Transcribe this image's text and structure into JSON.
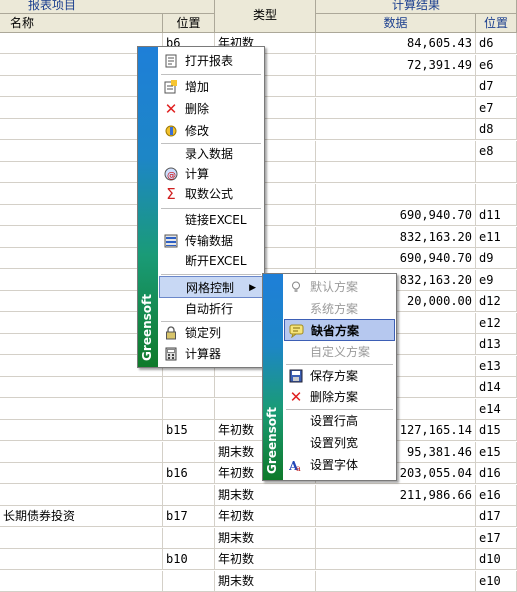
{
  "header": {
    "group_report_item": "报表项目",
    "col_name": "名称",
    "col_position": "位置",
    "col_type": "类型",
    "group_calc_result": "计算结果",
    "col_data": "数据",
    "col_position2": "位置"
  },
  "rows": [
    {
      "name": "",
      "pos": "b6",
      "type": "年初数",
      "data": "84,605.43",
      "pos2": "d6"
    },
    {
      "name": "",
      "pos": "",
      "type": "",
      "data": "72,391.49",
      "pos2": "e6"
    },
    {
      "name": "",
      "pos": "",
      "type": "",
      "data": "",
      "pos2": "d7"
    },
    {
      "name": "",
      "pos": "",
      "type": "",
      "data": "",
      "pos2": "e7"
    },
    {
      "name": "",
      "pos": "",
      "type": "",
      "data": "",
      "pos2": "d8"
    },
    {
      "name": "",
      "pos": "",
      "type": "",
      "data": "",
      "pos2": "e8"
    },
    {
      "name": "",
      "pos": "",
      "type": "",
      "data": "",
      "pos2": ""
    },
    {
      "name": "",
      "pos": "",
      "type": "",
      "data": "",
      "pos2": ""
    },
    {
      "name": "",
      "pos": "",
      "type": "",
      "data": "690,940.70",
      "pos2": "d11"
    },
    {
      "name": "",
      "pos": "",
      "type": "",
      "data": "832,163.20",
      "pos2": "e11"
    },
    {
      "name": "",
      "pos": "",
      "type": "",
      "data": "690,940.70",
      "pos2": "d9"
    },
    {
      "name": "",
      "pos": "",
      "type": "",
      "data": "832,163.20",
      "pos2": "e9"
    },
    {
      "name": "",
      "pos": "",
      "type": "",
      "data": "20,000.00",
      "pos2": "d12"
    },
    {
      "name": "",
      "pos": "",
      "type": "",
      "data": "",
      "pos2": "e12"
    },
    {
      "name": "",
      "pos": "",
      "type": "",
      "data": "",
      "pos2": "d13"
    },
    {
      "name": "",
      "pos": "",
      "type": "",
      "data": "",
      "pos2": "e13"
    },
    {
      "name": "",
      "pos": "",
      "type": "",
      "data": "",
      "pos2": "d14"
    },
    {
      "name": "",
      "pos": "",
      "type": "",
      "data": "",
      "pos2": "e14"
    },
    {
      "name": "",
      "pos": "b15",
      "type": "年初数",
      "data": "127,165.14",
      "pos2": "d15"
    },
    {
      "name": "",
      "pos": "",
      "type": "期末数",
      "data": "95,381.46",
      "pos2": "e15"
    },
    {
      "name": "",
      "pos": "b16",
      "type": "年初数",
      "data": "203,055.04",
      "pos2": "d16"
    },
    {
      "name": "",
      "pos": "",
      "type": "期末数",
      "data": "211,986.66",
      "pos2": "e16"
    },
    {
      "name": "长期债券投资",
      "pos": "b17",
      "type": "年初数",
      "data": "",
      "pos2": "d17"
    },
    {
      "name": "",
      "pos": "",
      "type": "期末数",
      "data": "",
      "pos2": "e17"
    },
    {
      "name": "",
      "pos": "b10",
      "type": "年初数",
      "data": "",
      "pos2": "d10"
    },
    {
      "name": "",
      "pos": "",
      "type": "期末数",
      "data": "",
      "pos2": "e10"
    }
  ],
  "context_menu": {
    "brand": "Greensoft",
    "items": [
      {
        "label": "打开报表",
        "icon": "open-report-icon"
      },
      {
        "label": "增加",
        "icon": "add-icon"
      },
      {
        "label": "删除",
        "icon": "delete-icon"
      },
      {
        "label": "修改",
        "icon": "edit-icon"
      },
      {
        "label": "录入数据",
        "icon": ""
      },
      {
        "label": "计算",
        "icon": "calculate-icon"
      },
      {
        "label": "取数公式",
        "icon": "sigma-icon"
      },
      {
        "label": "链接EXCEL",
        "icon": ""
      },
      {
        "label": "传输数据",
        "icon": "transfer-icon"
      },
      {
        "label": "断开EXCEL",
        "icon": ""
      },
      {
        "label": "网格控制",
        "icon": "",
        "submenu": true
      },
      {
        "label": "自动折行",
        "icon": ""
      },
      {
        "label": "锁定列",
        "icon": "lock-icon"
      },
      {
        "label": "计算器",
        "icon": "calculator-icon"
      }
    ]
  },
  "submenu": {
    "brand": "Greensoft",
    "items": [
      {
        "label": "默认方案",
        "icon": "lightbulb-icon",
        "disabled": true
      },
      {
        "label": "系统方案",
        "icon": "",
        "disabled": true
      },
      {
        "label": "缺省方案",
        "icon": "chat-icon",
        "selected": true
      },
      {
        "label": "自定义方案",
        "icon": "",
        "disabled": true
      },
      {
        "label": "保存方案",
        "icon": "save-scheme-icon"
      },
      {
        "label": "删除方案",
        "icon": "delete-icon"
      },
      {
        "label": "设置行高",
        "icon": ""
      },
      {
        "label": "设置列宽",
        "icon": ""
      },
      {
        "label": "设置字体",
        "icon": "font-icon"
      }
    ]
  },
  "colors": {
    "header_bg": "#ece9d8",
    "header_text_blue": "#1b3f8f",
    "menu_highlight": "#c8d8f4",
    "band_top": "#1e7fd8",
    "band_bottom": "#0f7a2a"
  }
}
